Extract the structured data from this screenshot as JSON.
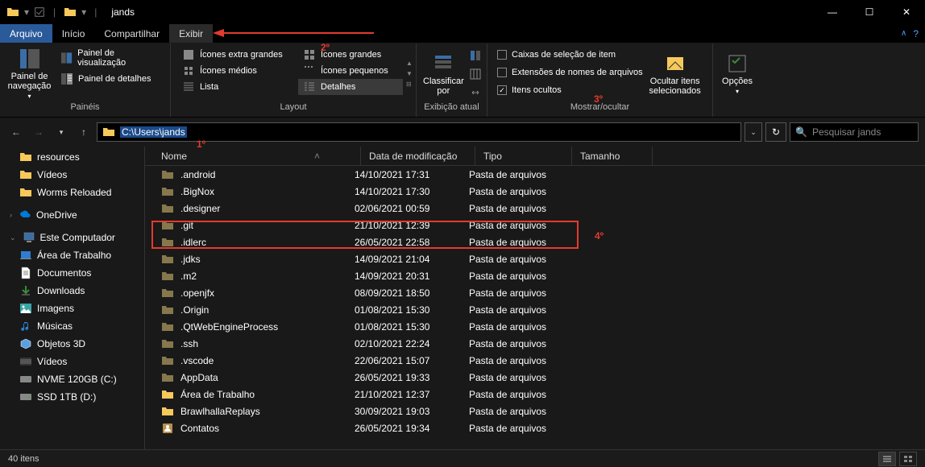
{
  "window": {
    "title": "jands",
    "min": "—",
    "max": "☐",
    "close": "✕"
  },
  "tabs": {
    "file": "Arquivo",
    "home": "Início",
    "share": "Compartilhar",
    "view": "Exibir"
  },
  "ribbon": {
    "panes": {
      "nav_panel": "Painel de\nnavegação",
      "preview": "Painel de visualização",
      "details": "Painel de detalhes",
      "group_label": "Painéis"
    },
    "layout": {
      "extra_large": "Ícones extra grandes",
      "large": "Ícones grandes",
      "medium": "Ícones médios",
      "small": "Ícones pequenos",
      "list": "Lista",
      "details": "Detalhes",
      "group_label": "Layout"
    },
    "current_view": {
      "sort_by": "Classificar\npor",
      "group_label": "Exibição atual"
    },
    "show_hide": {
      "item_checkboxes": "Caixas de seleção de item",
      "file_ext": "Extensões de nomes de arquivos",
      "hidden_items": "Itens ocultos",
      "hide_selected": "Ocultar itens\nselecionados",
      "group_label": "Mostrar/ocultar"
    },
    "options": "Opções"
  },
  "address": {
    "path": "C:\\Users\\jands",
    "search_placeholder": "Pesquisar jands"
  },
  "columns": {
    "name": "Nome",
    "date": "Data de modificação",
    "type": "Tipo",
    "size": "Tamanho"
  },
  "sidebar": {
    "resources": "resources",
    "videos": "Vídeos",
    "worms": "Worms Reloaded",
    "onedrive": "OneDrive",
    "this_pc": "Este Computador",
    "desktop": "Área de Trabalho",
    "documents": "Documentos",
    "downloads": "Downloads",
    "images": "Imagens",
    "music": "Músicas",
    "objects3d": "Objetos 3D",
    "videos2": "Vídeos",
    "nvme": "NVME 120GB (C:)",
    "ssd": "SSD 1TB (D:)"
  },
  "files": [
    {
      "name": ".android",
      "date": "14/10/2021 17:31",
      "type": "Pasta de arquivos",
      "hidden": true
    },
    {
      "name": ".BigNox",
      "date": "14/10/2021 17:30",
      "type": "Pasta de arquivos",
      "hidden": true
    },
    {
      "name": ".designer",
      "date": "02/06/2021 00:59",
      "type": "Pasta de arquivos",
      "hidden": true
    },
    {
      "name": ".git",
      "date": "21/10/2021 12:39",
      "type": "Pasta de arquivos",
      "hidden": true
    },
    {
      "name": ".idlerc",
      "date": "26/05/2021 22:58",
      "type": "Pasta de arquivos",
      "hidden": true
    },
    {
      "name": ".jdks",
      "date": "14/09/2021 21:04",
      "type": "Pasta de arquivos",
      "hidden": true
    },
    {
      "name": ".m2",
      "date": "14/09/2021 20:31",
      "type": "Pasta de arquivos",
      "hidden": true
    },
    {
      "name": ".openjfx",
      "date": "08/09/2021 18:50",
      "type": "Pasta de arquivos",
      "hidden": true
    },
    {
      "name": ".Origin",
      "date": "01/08/2021 15:30",
      "type": "Pasta de arquivos",
      "hidden": true
    },
    {
      "name": ".QtWebEngineProcess",
      "date": "01/08/2021 15:30",
      "type": "Pasta de arquivos",
      "hidden": true
    },
    {
      "name": ".ssh",
      "date": "02/10/2021 22:24",
      "type": "Pasta de arquivos",
      "hidden": true
    },
    {
      "name": ".vscode",
      "date": "22/06/2021 15:07",
      "type": "Pasta de arquivos",
      "hidden": true
    },
    {
      "name": "AppData",
      "date": "26/05/2021 19:33",
      "type": "Pasta de arquivos",
      "hidden": true
    },
    {
      "name": "Área de Trabalho",
      "date": "21/10/2021 12:37",
      "type": "Pasta de arquivos",
      "hidden": false
    },
    {
      "name": "BrawlhallaReplays",
      "date": "30/09/2021 19:03",
      "type": "Pasta de arquivos",
      "hidden": false
    },
    {
      "name": "Contatos",
      "date": "26/05/2021 19:34",
      "type": "Pasta de arquivos",
      "hidden": false,
      "icon": "contacts"
    }
  ],
  "status": {
    "count": "40 itens"
  },
  "annotations": {
    "a1": "1º",
    "a2": "2º",
    "a3": "3º",
    "a4": "4º"
  }
}
